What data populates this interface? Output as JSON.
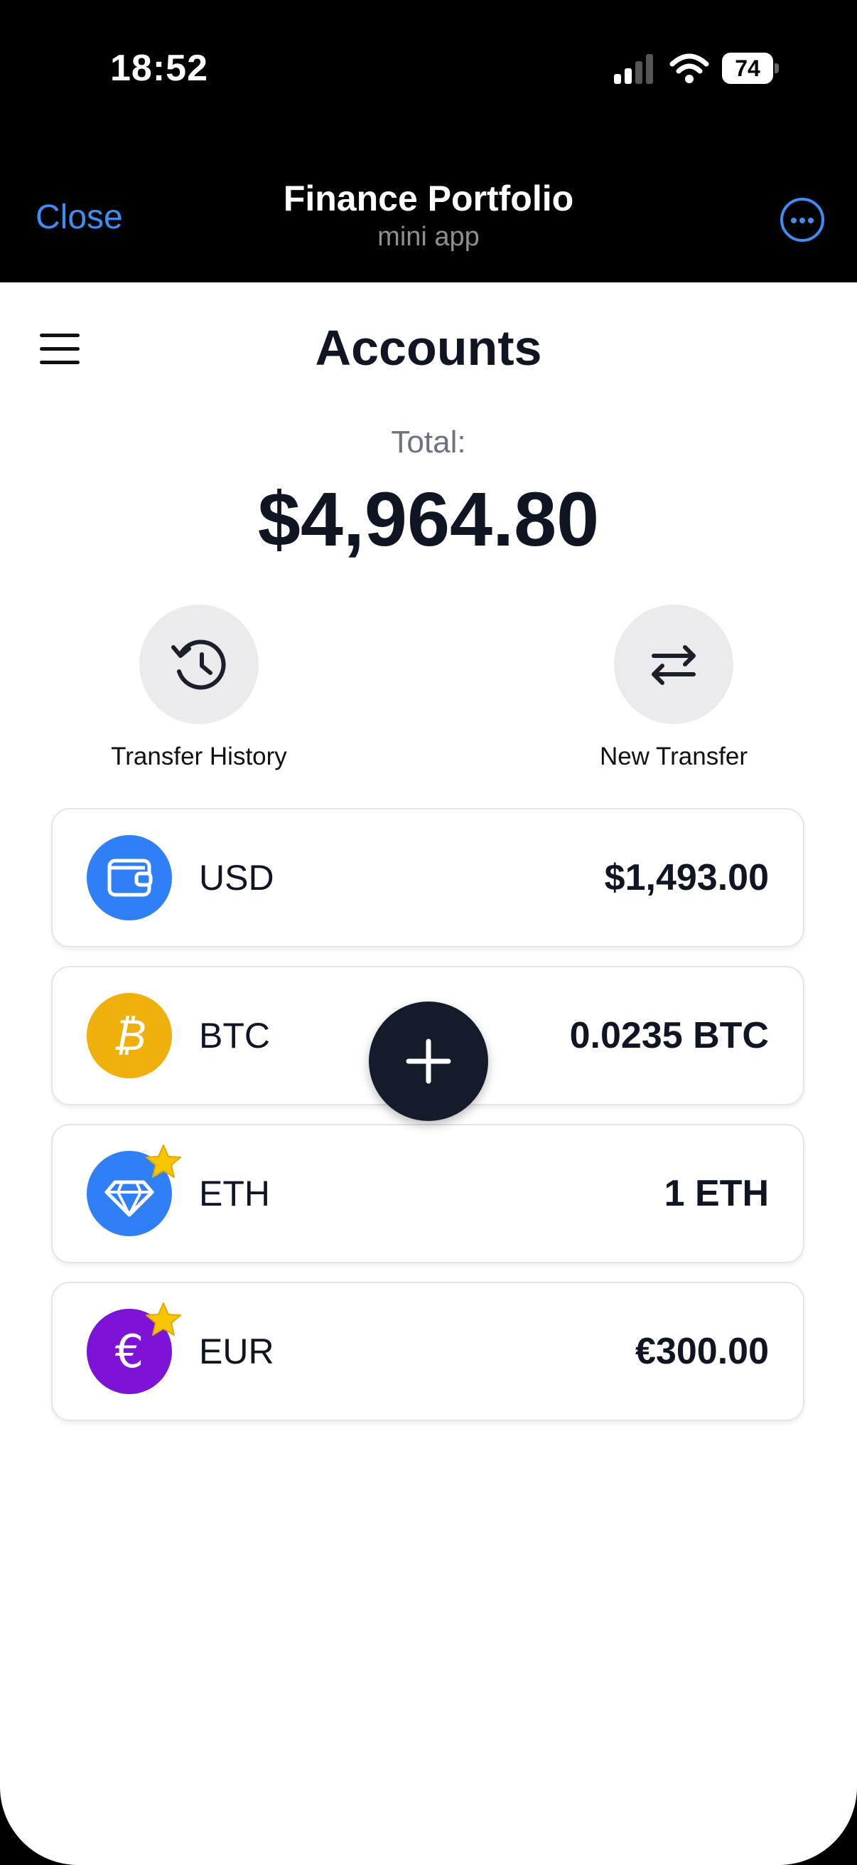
{
  "status_bar": {
    "time": "18:52",
    "battery": "74"
  },
  "nav": {
    "close_label": "Close",
    "title": "Finance Portfolio",
    "subtitle": "mini app"
  },
  "page": {
    "title": "Accounts",
    "total_label": "Total:",
    "total_value": "$4,964.80"
  },
  "actions": [
    {
      "label": "Transfer History",
      "icon": "history-icon"
    },
    {
      "label": "New Transfer",
      "icon": "swap-arrows-icon"
    }
  ],
  "accounts": [
    {
      "currency": "USD",
      "amount": "$1,493.00",
      "icon": "wallet-icon",
      "color": "#2f80f6",
      "favorite": false
    },
    {
      "currency": "BTC",
      "amount": "0.0235 BTC",
      "icon": "bitcoin-icon",
      "color": "#f0b00b",
      "favorite": false
    },
    {
      "currency": "ETH",
      "amount": "1 ETH",
      "icon": "diamond-icon",
      "color": "#2f80f6",
      "favorite": true
    },
    {
      "currency": "EUR",
      "amount": "€300.00",
      "icon": "euro-icon",
      "color": "#7d13d6",
      "favorite": true
    }
  ],
  "colors": {
    "accent": "#3d8ef0",
    "star": "#f7c600",
    "fab": "#141b2b"
  },
  "fab": {
    "icon": "plus-icon"
  }
}
